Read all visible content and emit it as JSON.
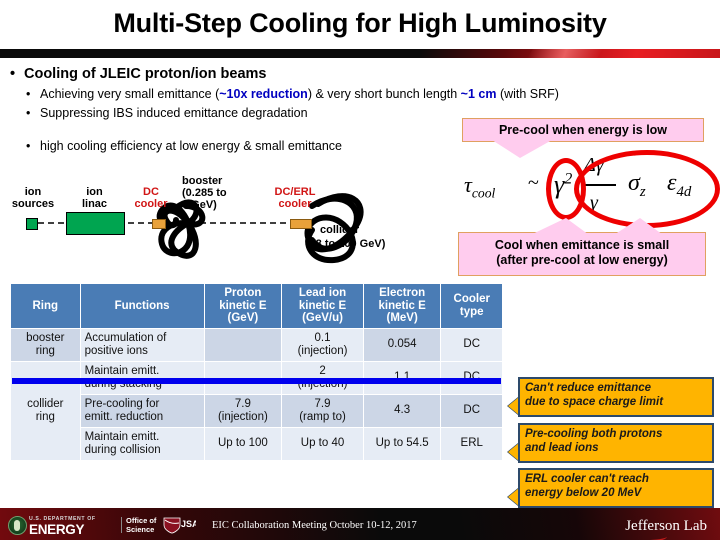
{
  "slide": {
    "title": "Multi-Step Cooling for High Luminosity"
  },
  "bullets": {
    "level1": "Cooling of JLEIC proton/ion beams",
    "sub1_pre": "Achieving very small emittance (",
    "sub1_hi1": "~10x reduction",
    "sub1_mid": ") & very short bunch length ",
    "sub1_hi2": "~1 cm",
    "sub1_post": " (with SRF)",
    "sub2": "Suppressing IBS induced emittance degradation",
    "sub3": "high cooling efficiency at low energy & small emittance",
    "dot": "•"
  },
  "diagram": {
    "ion_sources": "ion\nsources",
    "ion_linac": "ion\nlinac",
    "dc_cooler": "DC\ncooler",
    "booster": "booster\n(0.285 to\n8 GeV)",
    "dcerl_cooler": "DC/ERL\ncooler",
    "collider": "collider",
    "collider_energy": "(8 to 100 GeV)"
  },
  "callouts": {
    "pink_top": "Pre-cool when energy is low",
    "pink_bottom_line1": "Cool when emittance is small",
    "pink_bottom_line2": "(after pre-cool at low energy)",
    "yellow1_line1": "Can't reduce emittance",
    "yellow1_line2": "due to space charge limit",
    "yellow2_line1": "Pre-cooling both protons",
    "yellow2_line2": "and lead ions",
    "yellow3_line1": "ERL cooler  can't reach",
    "yellow3_line2": "energy below  20 MeV"
  },
  "formula": {
    "tau": "τ",
    "tau_sub": "cool",
    "tilde": "~",
    "gamma": "γ",
    "gamma_sup": "2",
    "delta_gamma": "Δγ",
    "gamma_den": "γ",
    "sigma": "σ",
    "sigma_sub": "z",
    "epsilon": "ε",
    "epsilon_sub": "4d"
  },
  "table": {
    "headers": [
      "Ring",
      "Functions",
      "Proton kinetic E (GeV)",
      "Lead ion kinetic E (GeV/u)",
      "Electron kinetic E (MeV)",
      "Cooler type"
    ],
    "headers_lines": [
      [
        "Ring"
      ],
      [
        "Functions"
      ],
      [
        "Proton",
        "kinetic E",
        "(GeV)"
      ],
      [
        "Lead ion",
        "kinetic E",
        "(GeV/u)"
      ],
      [
        "Electron",
        "kinetic E",
        "(MeV)"
      ],
      [
        "Cooler",
        "type"
      ]
    ],
    "rows": [
      {
        "ring": "booster\nring",
        "function": "Accumulation of\npositive ions",
        "proton": "",
        "lead": "0.1\n(injection)",
        "electron": "0.054",
        "cooler": "DC"
      },
      {
        "ring": "collider\nring",
        "function": "Maintain emitt.\nduring stacking",
        "proton": "",
        "lead": "2\n(injection)",
        "electron": "1.1",
        "cooler": "DC"
      },
      {
        "ring": "",
        "function": "Pre-cooling for\nemitt. reduction",
        "proton": "7.9\n(injection)",
        "lead": "7.9\n(ramp to)",
        "electron": "4.3",
        "cooler": "DC"
      },
      {
        "ring": "",
        "function": "Maintain emitt.\nduring collision",
        "proton": "Up to 100",
        "lead": "Up to 40",
        "electron": "Up to 54.5",
        "cooler": "ERL"
      }
    ]
  },
  "footer": {
    "doe_small": "U.S. DEPARTMENT OF",
    "doe_big": "ENERGY",
    "office_line1": "Office of",
    "office_line2": "Science",
    "jsa": "JSA",
    "center": "EIC Collaboration Meeting October 10-12, 2017",
    "jlab": "Jefferson Lab"
  },
  "colors": {
    "title_text": "#000000",
    "accent_red": "#e81e23",
    "highlight_blue": "#0000c0",
    "table_header_blue": "#4a7cb5",
    "separator_blue": "#0000ee",
    "pink_callout": "#ffccee",
    "yellow_callout": "#ffb400",
    "ellipse_red": "#ee0000",
    "linac_green": "#00a550",
    "cooler_orange": "#e8a13a"
  }
}
